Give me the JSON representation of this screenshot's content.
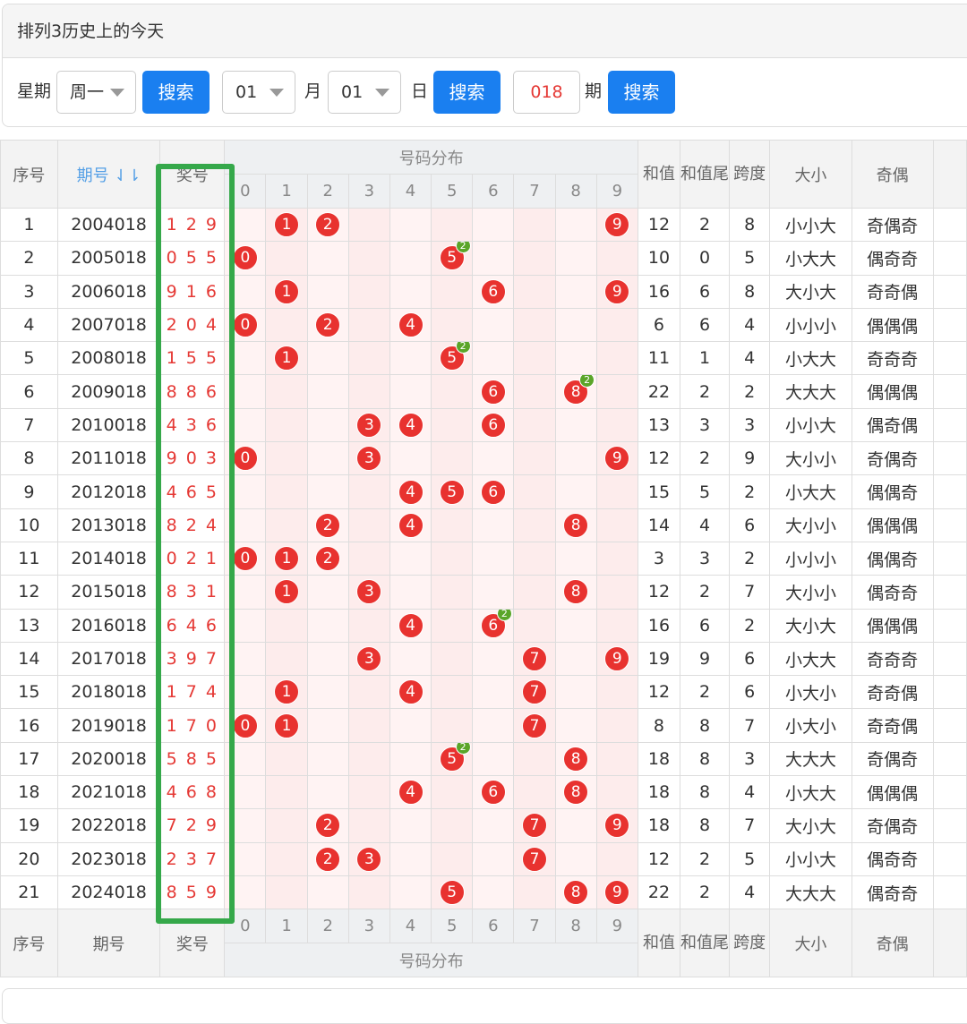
{
  "panel": {
    "title": "排列3历史上的今天",
    "weekday_label": "星期",
    "weekday_value": "周一",
    "search_label": "搜索",
    "month_value": "01",
    "month_label": "月",
    "day_value": "01",
    "day_label": "日",
    "period_value": "018",
    "period_label": "期"
  },
  "table": {
    "header": {
      "seq": "序号",
      "issue": "期号",
      "sort_icon": "⇃⇂",
      "prize": "奖号",
      "dist": "号码分布",
      "digits": [
        "0",
        "1",
        "2",
        "3",
        "4",
        "5",
        "6",
        "7",
        "8",
        "9"
      ],
      "sum": "和值",
      "sum_tail": "和值尾",
      "span": "跨度",
      "size": "大小",
      "parity": "奇偶"
    },
    "rows": [
      {
        "seq": "1",
        "issue": "2004018",
        "prize": "1 2 9",
        "sum": "12",
        "tail": "2",
        "span": "8",
        "size": "小小大",
        "parity": "奇偶奇",
        "balls": [
          1,
          2,
          9
        ],
        "rep": null
      },
      {
        "seq": "2",
        "issue": "2005018",
        "prize": "0 5 5",
        "sum": "10",
        "tail": "0",
        "span": "5",
        "size": "小大大",
        "parity": "偶奇奇",
        "balls": [
          0,
          5
        ],
        "rep": 5
      },
      {
        "seq": "3",
        "issue": "2006018",
        "prize": "9 1 6",
        "sum": "16",
        "tail": "6",
        "span": "8",
        "size": "大小大",
        "parity": "奇奇偶",
        "balls": [
          1,
          6,
          9
        ],
        "rep": null
      },
      {
        "seq": "4",
        "issue": "2007018",
        "prize": "2 0 4",
        "sum": "6",
        "tail": "6",
        "span": "4",
        "size": "小小小",
        "parity": "偶偶偶",
        "balls": [
          0,
          2,
          4
        ],
        "rep": null
      },
      {
        "seq": "5",
        "issue": "2008018",
        "prize": "1 5 5",
        "sum": "11",
        "tail": "1",
        "span": "4",
        "size": "小大大",
        "parity": "奇奇奇",
        "balls": [
          1,
          5
        ],
        "rep": 5
      },
      {
        "seq": "6",
        "issue": "2009018",
        "prize": "8 8 6",
        "sum": "22",
        "tail": "2",
        "span": "2",
        "size": "大大大",
        "parity": "偶偶偶",
        "balls": [
          6,
          8
        ],
        "rep": 8
      },
      {
        "seq": "7",
        "issue": "2010018",
        "prize": "4 3 6",
        "sum": "13",
        "tail": "3",
        "span": "3",
        "size": "小小大",
        "parity": "偶奇偶",
        "balls": [
          3,
          4,
          6
        ],
        "rep": null
      },
      {
        "seq": "8",
        "issue": "2011018",
        "prize": "9 0 3",
        "sum": "12",
        "tail": "2",
        "span": "9",
        "size": "大小小",
        "parity": "奇偶奇",
        "balls": [
          0,
          3,
          9
        ],
        "rep": null
      },
      {
        "seq": "9",
        "issue": "2012018",
        "prize": "4 6 5",
        "sum": "15",
        "tail": "5",
        "span": "2",
        "size": "小大大",
        "parity": "偶偶奇",
        "balls": [
          4,
          5,
          6
        ],
        "rep": null
      },
      {
        "seq": "10",
        "issue": "2013018",
        "prize": "8 2 4",
        "sum": "14",
        "tail": "4",
        "span": "6",
        "size": "大小小",
        "parity": "偶偶偶",
        "balls": [
          2,
          4,
          8
        ],
        "rep": null
      },
      {
        "seq": "11",
        "issue": "2014018",
        "prize": "0 2 1",
        "sum": "3",
        "tail": "3",
        "span": "2",
        "size": "小小小",
        "parity": "偶偶奇",
        "balls": [
          0,
          1,
          2
        ],
        "rep": null
      },
      {
        "seq": "12",
        "issue": "2015018",
        "prize": "8 3 1",
        "sum": "12",
        "tail": "2",
        "span": "7",
        "size": "大小小",
        "parity": "偶奇奇",
        "balls": [
          1,
          3,
          8
        ],
        "rep": null
      },
      {
        "seq": "13",
        "issue": "2016018",
        "prize": "6 4 6",
        "sum": "16",
        "tail": "6",
        "span": "2",
        "size": "大小大",
        "parity": "偶偶偶",
        "balls": [
          4,
          6
        ],
        "rep": 6
      },
      {
        "seq": "14",
        "issue": "2017018",
        "prize": "3 9 7",
        "sum": "19",
        "tail": "9",
        "span": "6",
        "size": "小大大",
        "parity": "奇奇奇",
        "balls": [
          3,
          7,
          9
        ],
        "rep": null
      },
      {
        "seq": "15",
        "issue": "2018018",
        "prize": "1 7 4",
        "sum": "12",
        "tail": "2",
        "span": "6",
        "size": "小大小",
        "parity": "奇奇偶",
        "balls": [
          1,
          4,
          7
        ],
        "rep": null
      },
      {
        "seq": "16",
        "issue": "2019018",
        "prize": "1 7 0",
        "sum": "8",
        "tail": "8",
        "span": "7",
        "size": "小大小",
        "parity": "奇奇偶",
        "balls": [
          0,
          1,
          7
        ],
        "rep": null
      },
      {
        "seq": "17",
        "issue": "2020018",
        "prize": "5 8 5",
        "sum": "18",
        "tail": "8",
        "span": "3",
        "size": "大大大",
        "parity": "奇偶奇",
        "balls": [
          5,
          8
        ],
        "rep": 5
      },
      {
        "seq": "18",
        "issue": "2021018",
        "prize": "4 6 8",
        "sum": "18",
        "tail": "8",
        "span": "4",
        "size": "小大大",
        "parity": "偶偶偶",
        "balls": [
          4,
          6,
          8
        ],
        "rep": null
      },
      {
        "seq": "19",
        "issue": "2022018",
        "prize": "7 2 9",
        "sum": "18",
        "tail": "8",
        "span": "7",
        "size": "大小大",
        "parity": "奇偶奇",
        "balls": [
          2,
          7,
          9
        ],
        "rep": null
      },
      {
        "seq": "20",
        "issue": "2023018",
        "prize": "2 3 7",
        "sum": "12",
        "tail": "2",
        "span": "5",
        "size": "小小大",
        "parity": "偶奇奇",
        "balls": [
          2,
          3,
          7
        ],
        "rep": null
      },
      {
        "seq": "21",
        "issue": "2024018",
        "prize": "8 5 9",
        "sum": "22",
        "tail": "2",
        "span": "4",
        "size": "大大大",
        "parity": "偶奇奇",
        "balls": [
          5,
          8,
          9
        ],
        "rep": null
      }
    ],
    "rep_count": "2",
    "colors": {
      "ball": "#e8322f",
      "repeat_badge": "#5aa529",
      "highlight": "#35a84a",
      "button": "#1a7ff0"
    }
  }
}
